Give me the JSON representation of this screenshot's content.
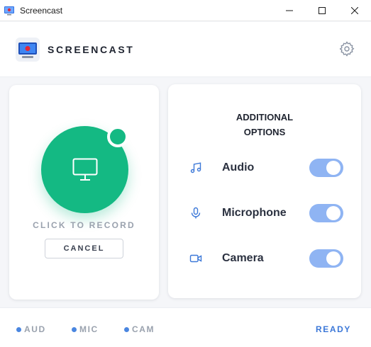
{
  "window": {
    "title": "Screencast",
    "controls": {
      "minimize": "minimize",
      "maximize": "maximize",
      "close": "close"
    }
  },
  "header": {
    "brand": "SCREENCAST",
    "settings_icon": "gear-icon"
  },
  "record": {
    "label": "CLICK TO RECORD",
    "cancel_label": "CANCEL",
    "icon": "monitor-icon",
    "accent": "#14b983"
  },
  "options": {
    "title_line1": "ADDITIONAL",
    "title_line2": "OPTIONS",
    "items": [
      {
        "label": "Audio",
        "icon": "music-note-icon",
        "enabled": true
      },
      {
        "label": "Microphone",
        "icon": "microphone-icon",
        "enabled": true
      },
      {
        "label": "Camera",
        "icon": "video-camera-icon",
        "enabled": true
      }
    ],
    "toggle_color": "#8fb4f3"
  },
  "footer": {
    "indicators": [
      {
        "label": "AUD"
      },
      {
        "label": "MIC"
      },
      {
        "label": "CAM"
      }
    ],
    "status": "READY",
    "status_color": "#3c78d8"
  }
}
